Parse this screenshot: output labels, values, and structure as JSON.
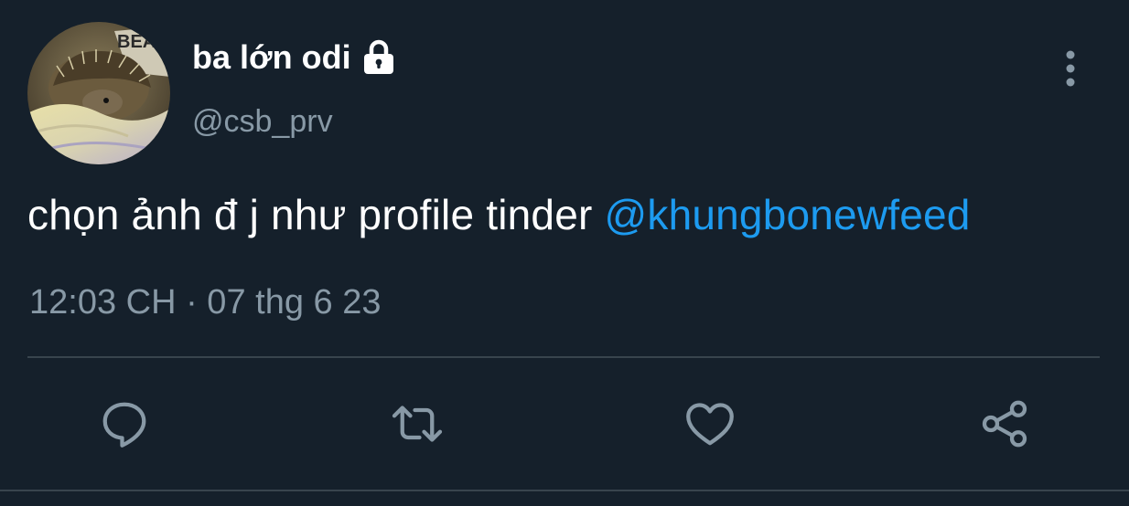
{
  "user": {
    "display_name": "ba lớn odi",
    "handle": "@csb_prv",
    "protected": true,
    "avatar_icon": "hedgehog-avatar"
  },
  "tweet": {
    "text": "chọn ảnh đ j như profile tinder ",
    "mention": "@khungbonewfeed",
    "timestamp": "12:03 CH · 07 thg 6 23"
  },
  "icons": {
    "more": "more-vertical-icon",
    "reply": "reply-icon",
    "retweet": "retweet-icon",
    "like": "heart-icon",
    "share": "share-icon",
    "lock": "lock-icon"
  },
  "colors": {
    "background": "#15202b",
    "text": "#ffffff",
    "secondary_text": "#8899a6",
    "accent": "#1d9bf0",
    "divider": "#38444d"
  }
}
